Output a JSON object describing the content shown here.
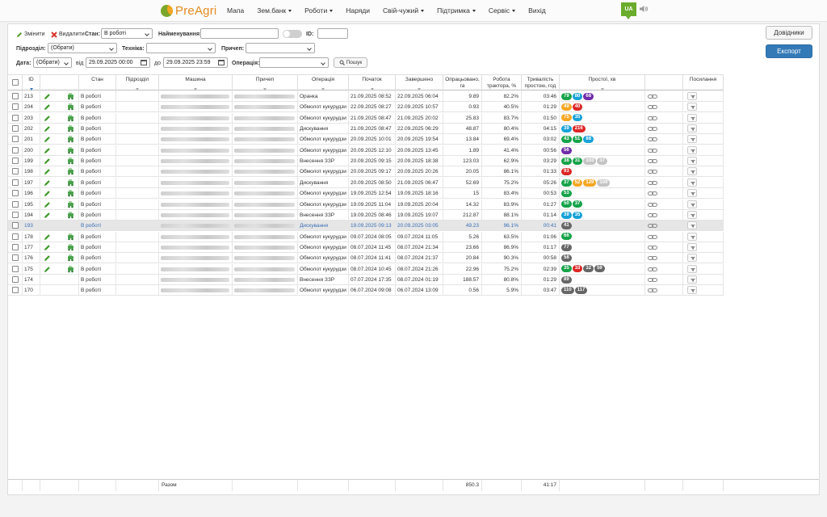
{
  "nav": {
    "brand": "PreAgri",
    "items": [
      {
        "label": "Мапа",
        "dropdown": false
      },
      {
        "label": "Зем.банк",
        "dropdown": true
      },
      {
        "label": "Роботи",
        "dropdown": true
      },
      {
        "label": "Наряди",
        "dropdown": false
      },
      {
        "label": "Свій-чужий",
        "dropdown": true
      },
      {
        "label": "Підтримка",
        "dropdown": true
      },
      {
        "label": "Сервіс",
        "dropdown": true
      },
      {
        "label": "Вихід",
        "dropdown": false
      }
    ],
    "lang": "UA"
  },
  "toolbar": {
    "edit_label": "Змінити",
    "delete_label": "Видалити",
    "state_label": "Стан:",
    "state_value": "В роботі",
    "name_label": "Найменування:",
    "name_value": "",
    "id_label": "ID:",
    "id_value": "",
    "division_label": "Підрозділ:",
    "division_value": "(Обрати)",
    "machine_label": "Техніка:",
    "machine_value": "",
    "trailer_label": "Причеп:",
    "trailer_value": "",
    "date_label": "Дата:",
    "date_value": "(Обрати)",
    "from_label": "від",
    "from_value": "29.09.2025 00:00",
    "to_label": "до",
    "to_value": "29.09.2025 23:59",
    "operation_label": "Операція:",
    "operation_value": "",
    "search_label": "Пошук",
    "refs_label": "Довідники",
    "export_label": "Експорт"
  },
  "columns": {
    "id": "ID",
    "state": "Стан",
    "division": "Підрозділ",
    "machine": "Машина",
    "trailer": "Причеп",
    "operation": "Операція",
    "start": "Початок",
    "end": "Завершено",
    "processed": "Опрацьовано, га",
    "tractor": "Робота трактора, %",
    "idle_duration": "Тривалість простою, год",
    "idle": "Простої, хв",
    "links": "Посилання"
  },
  "colors": {
    "green": "#16a34a",
    "blue": "#17a2d8",
    "purple": "#6f2da8",
    "red": "#dc2626",
    "orange": "#f5a623",
    "lightgray": "#c4c4c4",
    "darkgray": "#666666"
  },
  "rows": [
    {
      "id": "213",
      "editable": true,
      "state": "В роботі",
      "operation": "Оранка",
      "start": "21.09.2025 08:52",
      "end": "22.09.2025 06:04",
      "processed": "9.89",
      "tractor": "82.2%",
      "idle_duration": "03:46",
      "idle": [
        [
          "79",
          "green"
        ],
        [
          "80",
          "blue"
        ],
        [
          "68",
          "purple"
        ]
      ]
    },
    {
      "id": "204",
      "editable": true,
      "state": "В роботі",
      "operation": "Обмолот кукурудзи",
      "start": "22.09.2025 08:27",
      "end": "22.09.2025 10:57",
      "processed": "0.93",
      "tractor": "40.5%",
      "idle_duration": "01:29",
      "idle": [
        [
          "49",
          "orange"
        ],
        [
          "40",
          "red"
        ]
      ]
    },
    {
      "id": "203",
      "editable": true,
      "state": "В роботі",
      "operation": "Обмолот кукурудзи",
      "start": "21.09.2025 08:47",
      "end": "21.09.2025 20:02",
      "processed": "25.83",
      "tractor": "83.7%",
      "idle_duration": "01:50",
      "idle": [
        [
          "75",
          "orange"
        ],
        [
          "35",
          "blue"
        ]
      ]
    },
    {
      "id": "202",
      "editable": true,
      "state": "В роботі",
      "operation": "Дискування",
      "start": "21.09.2025 08:47",
      "end": "22.09.2025 06:29",
      "processed": "48.87",
      "tractor": "80.4%",
      "idle_duration": "04:15",
      "idle": [
        [
          "39",
          "blue"
        ],
        [
          "216",
          "red"
        ]
      ]
    },
    {
      "id": "201",
      "editable": true,
      "state": "В роботі",
      "operation": "Обмолот кукурудзи",
      "start": "20.09.2025 10:01",
      "end": "20.09.2025 19:54",
      "processed": "13.84",
      "tractor": "69.4%",
      "idle_duration": "03:02",
      "idle": [
        [
          "43",
          "green"
        ],
        [
          "51",
          "green"
        ],
        [
          "88",
          "blue"
        ]
      ]
    },
    {
      "id": "200",
      "editable": true,
      "state": "В роботі",
      "operation": "Обмолот кукурудзи",
      "start": "20.09.2025 12:10",
      "end": "20.09.2025 13:45",
      "processed": "1.89",
      "tractor": "41.4%",
      "idle_duration": "00:56",
      "idle": [
        [
          "56",
          "purple"
        ]
      ]
    },
    {
      "id": "199",
      "editable": true,
      "state": "В роботі",
      "operation": "Внесення ЗЗР",
      "start": "20.09.2025 09:15",
      "end": "20.09.2025 18:38",
      "processed": "123.03",
      "tractor": "62.9%",
      "idle_duration": "03:29",
      "idle": [
        [
          "38",
          "green"
        ],
        [
          "31",
          "green"
        ],
        [
          "103",
          "lightgray"
        ],
        [
          "37",
          "lightgray"
        ]
      ]
    },
    {
      "id": "198",
      "editable": true,
      "state": "В роботі",
      "operation": "Обмолот кукурудзи",
      "start": "20.09.2025 09:17",
      "end": "20.09.2025 20:26",
      "processed": "20.05",
      "tractor": "86.1%",
      "idle_duration": "01:33",
      "idle": [
        [
          "93",
          "red"
        ]
      ]
    },
    {
      "id": "197",
      "editable": true,
      "state": "В роботі",
      "operation": "Дискування",
      "start": "20.09.2025 08:50",
      "end": "21.09.2025 06:47",
      "processed": "52.69",
      "tractor": "75.2%",
      "idle_duration": "05:26",
      "idle": [
        [
          "37",
          "green"
        ],
        [
          "52",
          "orange"
        ],
        [
          "129",
          "orange"
        ],
        [
          "109",
          "lightgray"
        ]
      ]
    },
    {
      "id": "196",
      "editable": true,
      "state": "В роботі",
      "operation": "Обмолот кукурудзи",
      "start": "19.09.2025 12:54",
      "end": "19.09.2025 18:16",
      "processed": "15",
      "tractor": "83.4%",
      "idle_duration": "00:53",
      "idle": [
        [
          "53",
          "green"
        ]
      ]
    },
    {
      "id": "195",
      "editable": true,
      "state": "В роботі",
      "operation": "Обмолот кукурудзи",
      "start": "19.09.2025 11:04",
      "end": "19.09.2025 20:04",
      "processed": "14.32",
      "tractor": "83.9%",
      "idle_duration": "01:27",
      "idle": [
        [
          "50",
          "green"
        ],
        [
          "37",
          "green"
        ]
      ]
    },
    {
      "id": "194",
      "editable": true,
      "state": "В роботі",
      "operation": "Внесення ЗЗР",
      "start": "19.09.2025 08:46",
      "end": "19.09.2025 19:07",
      "processed": "212.87",
      "tractor": "88.1%",
      "idle_duration": "01:14",
      "idle": [
        [
          "39",
          "blue"
        ],
        [
          "35",
          "blue"
        ]
      ]
    },
    {
      "id": "193",
      "editable": false,
      "selected": true,
      "state": "В роботі",
      "operation": "Дискування",
      "start": "19.09.2025 09:13",
      "end": "20.09.2025 03:05",
      "processed": "49.23",
      "tractor": "96.1%",
      "idle_duration": "00:41",
      "idle": [
        [
          "41",
          "darkgray"
        ]
      ]
    },
    {
      "id": "178",
      "editable": true,
      "state": "В роботі",
      "operation": "Обмолот кукурудзи",
      "start": "09.07.2024 08:05",
      "end": "09.07.2024 11:05",
      "processed": "5.26",
      "tractor": "63.5%",
      "idle_duration": "01:06",
      "idle": [
        [
          "66",
          "green"
        ]
      ]
    },
    {
      "id": "177",
      "editable": true,
      "state": "В роботі",
      "operation": "Обмолот кукурудзи",
      "start": "08.07.2024 11:45",
      "end": "08.07.2024 21:34",
      "processed": "23.66",
      "tractor": "86.9%",
      "idle_duration": "01:17",
      "idle": [
        [
          "77",
          "darkgray"
        ]
      ]
    },
    {
      "id": "176",
      "editable": true,
      "state": "В роботі",
      "operation": "Обмолот кукурудзи",
      "start": "08.07.2024 11:41",
      "end": "08.07.2024 21:37",
      "processed": "20.84",
      "tractor": "90.3%",
      "idle_duration": "00:58",
      "idle": [
        [
          "58",
          "darkgray"
        ]
      ]
    },
    {
      "id": "175",
      "editable": true,
      "state": "В роботі",
      "operation": "Обмолот кукурудзи",
      "start": "08.07.2024 10:45",
      "end": "08.07.2024 21:26",
      "processed": "22.96",
      "tractor": "75.2%",
      "idle_duration": "02:39",
      "idle": [
        [
          "35",
          "green"
        ],
        [
          "33",
          "red"
        ],
        [
          "32",
          "darkgray"
        ],
        [
          "59",
          "darkgray"
        ]
      ]
    },
    {
      "id": "174",
      "editable": false,
      "state": "В роботі",
      "operation": "Внесення ЗЗР",
      "start": "07.07.2024 17:35",
      "end": "08.07.2024 01:19",
      "processed": "188.57",
      "tractor": "80.8%",
      "idle_duration": "01:29",
      "idle": [
        [
          "89",
          "darkgray"
        ]
      ]
    },
    {
      "id": "170",
      "editable": false,
      "state": "В роботі",
      "operation": "Обмолот кукурудзи",
      "start": "06.07.2024 09:08",
      "end": "06.07.2024 13:09",
      "processed": "0.56",
      "tractor": "5.9%",
      "idle_duration": "03:47",
      "idle": [
        [
          "110",
          "darkgray"
        ],
        [
          "117",
          "darkgray"
        ]
      ]
    }
  ],
  "totals": {
    "label": "Разом",
    "processed": "850.3",
    "idle_duration": "41:17"
  }
}
